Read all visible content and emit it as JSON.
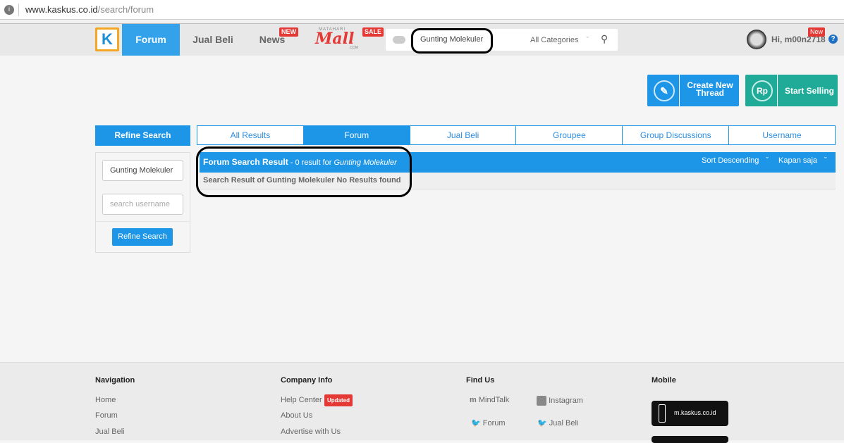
{
  "browser": {
    "url_domain": "www.kaskus.co.id",
    "url_path": "/search/forum"
  },
  "header": {
    "logo": "K",
    "nav": [
      {
        "label": "Forum"
      },
      {
        "label": "Jual Beli"
      },
      {
        "label": "News",
        "badge": "NEW"
      }
    ],
    "mall": {
      "top": "MATAHARI",
      "name": "Mall",
      "sub": ".COM",
      "badge": "SALE"
    },
    "search_value": "Gunting Molekuler",
    "category": "All Categories",
    "greeting": "Hi, m00n2718",
    "new_badge": "New",
    "help": "?"
  },
  "actions": {
    "create": "Create New Thread",
    "sell": "Start Selling",
    "rp": "Rp"
  },
  "sidebar": {
    "title": "Refine Search",
    "keyword": "Gunting Molekuler",
    "username_placeholder": "search username",
    "button": "Refine Search"
  },
  "tabs": [
    "All Results",
    "Forum",
    "Jual Beli",
    "Groupee",
    "Group Discussions",
    "Username"
  ],
  "result": {
    "title": "Forum Search Result",
    "count_text": " - 0 result for ",
    "query": "Gunting Molekuler",
    "sort": "Sort Descending",
    "time": "Kapan saja",
    "message": "Search Result of Gunting Molekuler No Results found"
  },
  "footer": {
    "navigation": {
      "title": "Navigation",
      "links": [
        "Home",
        "Forum",
        "Jual Beli"
      ]
    },
    "company": {
      "title": "Company Info",
      "links": [
        "Help Center",
        "About Us",
        "Advertise with Us"
      ],
      "badge": "Updated"
    },
    "findus": {
      "title": "Find Us",
      "links": [
        "MindTalk",
        "Instagram",
        "Forum",
        "Jual Beli"
      ]
    },
    "mobile": {
      "title": "Mobile",
      "app": "m.kaskus.co.id"
    }
  },
  "colors": {
    "primary": "#1e96e8",
    "teal": "#1fab98",
    "orange": "#f5a623",
    "badge": "#e53935"
  }
}
